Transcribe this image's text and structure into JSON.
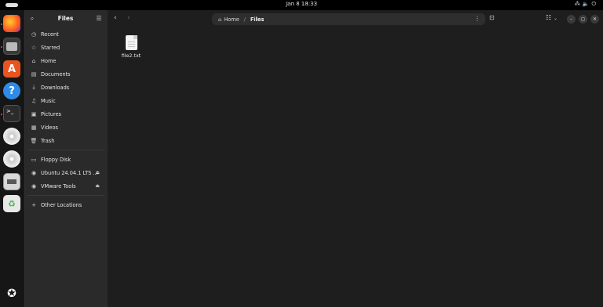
{
  "topbar": {
    "clock": "Jan 8  18:33"
  },
  "dock": {
    "apps": [
      {
        "name": "firefox",
        "glyph": ""
      },
      {
        "name": "files",
        "glyph": ""
      },
      {
        "name": "app-center",
        "glyph": "A"
      },
      {
        "name": "help",
        "glyph": "?"
      },
      {
        "name": "terminal",
        "glyph": ">_"
      },
      {
        "name": "disc-1",
        "glyph": ""
      },
      {
        "name": "disc-2",
        "glyph": ""
      },
      {
        "name": "floppy",
        "glyph": ""
      },
      {
        "name": "trash",
        "glyph": "♻"
      }
    ]
  },
  "sidebar": {
    "title": "Files",
    "items": [
      {
        "label": "Recent",
        "icon": "clock-icon",
        "glyph": "◷"
      },
      {
        "label": "Starred",
        "icon": "star-icon",
        "glyph": "☆"
      },
      {
        "label": "Home",
        "icon": "home-icon",
        "glyph": "⌂"
      },
      {
        "label": "Documents",
        "icon": "document-icon",
        "glyph": "▤"
      },
      {
        "label": "Downloads",
        "icon": "download-icon",
        "glyph": "⤓"
      },
      {
        "label": "Music",
        "icon": "music-icon",
        "glyph": "♫"
      },
      {
        "label": "Pictures",
        "icon": "picture-icon",
        "glyph": "▣"
      },
      {
        "label": "Videos",
        "icon": "video-icon",
        "glyph": "▦"
      },
      {
        "label": "Trash",
        "icon": "trash-icon",
        "glyph": "🗑"
      }
    ],
    "devices": [
      {
        "label": "Floppy Disk",
        "icon": "floppy-icon",
        "glyph": "▭"
      },
      {
        "label": "Ubuntu 24.04.1 LTS ...",
        "icon": "disc-icon",
        "glyph": "◉",
        "eject": true
      },
      {
        "label": "VMware Tools",
        "icon": "disc-icon",
        "glyph": "◉",
        "eject": true
      }
    ],
    "other": {
      "label": "Other Locations",
      "glyph": "+"
    }
  },
  "pathbar": {
    "home": "Home",
    "current": "Files"
  },
  "files": [
    {
      "name": "file2.txt"
    }
  ]
}
